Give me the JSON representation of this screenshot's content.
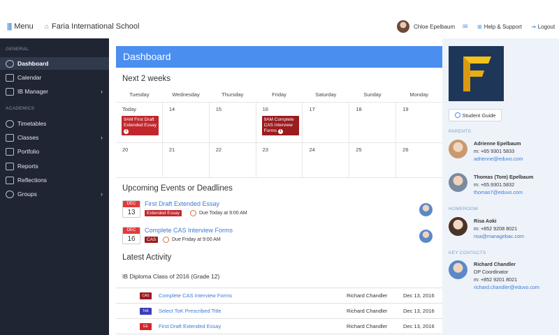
{
  "topbar": {
    "menu_label": "Menu",
    "school_name": "Faria International School",
    "user_name": "Chloe Epelbaum",
    "help_label": "Help & Support",
    "logout_label": "Logout"
  },
  "sidebar": {
    "sections": [
      "GENERAL",
      "ACADEMICS"
    ],
    "items": [
      {
        "label": "Dashboard",
        "icon": "dashboard-icon"
      },
      {
        "label": "Calendar",
        "icon": "calendar-icon"
      },
      {
        "label": "IB Manager",
        "icon": "ib-manager-icon"
      },
      {
        "label": "Timetables",
        "icon": "clock-icon"
      },
      {
        "label": "Classes",
        "icon": "classes-icon"
      },
      {
        "label": "Portfolio",
        "icon": "folder-icon"
      },
      {
        "label": "Reports",
        "icon": "reports-icon"
      },
      {
        "label": "Reflections",
        "icon": "reflections-icon"
      },
      {
        "label": "Groups",
        "icon": "groups-icon"
      }
    ]
  },
  "main": {
    "header": "Dashboard",
    "next_title": "Next 2 weeks",
    "days": [
      "Tuesday",
      "Wednesday",
      "Thursday",
      "Friday",
      "Saturday",
      "Sunday",
      "Monday"
    ],
    "week1": [
      "Today",
      "14",
      "15",
      "16",
      "17",
      "18",
      "19"
    ],
    "week2": [
      "20",
      "21",
      "22",
      "23",
      "24",
      "25",
      "26"
    ],
    "cal_event1": "9AM First Draft Extended Essay",
    "cal_event2": "9AM Complete CAS Interview Forms",
    "upcoming_title": "Upcoming Events or Deadlines",
    "events": [
      {
        "month": "DEC",
        "day": "13",
        "title": "First Draft Extended Essay",
        "tag": "Extended Essay",
        "due": "Due Today at 9:00 AM"
      },
      {
        "month": "DEC",
        "day": "16",
        "title": "Complete CAS Interview Forms",
        "tag": "CAS",
        "due": "Due Friday at 9:00 AM"
      }
    ],
    "latest_title": "Latest Activity",
    "class_label": "IB Diploma Class of 2016 (Grade 12)",
    "activity": [
      {
        "badge": "CAS",
        "title": "Complete CAS Interview Forms",
        "person": "Richard Chandler",
        "date": "Dec 13, 2016",
        "color": "#9b1b1f"
      },
      {
        "badge": "ToK",
        "title": "Select ToK Prescribed Title",
        "person": "Richard Chandler",
        "date": "Dec 13, 2016",
        "color": "#3b3fb8"
      },
      {
        "badge": "EE",
        "title": "First Draft Extended Essay",
        "person": "Richard Chandler",
        "date": "Dec 13, 2016",
        "color": "#d4262c"
      }
    ]
  },
  "right": {
    "guide_label": "Student Guide",
    "parents_label": "PARENTS",
    "parents": [
      {
        "name": "Adrienne Epelbaum",
        "phone": "m: +65 9301 5833",
        "email": "adrienne@eduvo.com"
      },
      {
        "name": "Thomas (Tom) Epelbaum",
        "phone": "m: +65.9301.5832",
        "email": "thomas7@eduvo.com"
      }
    ],
    "homeroom_label": "HOMEROOM",
    "homeroom": {
      "name": "Risa Aoki",
      "phone": "m: +852 9208 8021",
      "email": "risa@managebac.com"
    },
    "key_label": "KEY CONTACTS",
    "key": {
      "name": "Richard Chandler",
      "role": "DP Coordinator",
      "phone": "m: +852 9201 8021",
      "email": "richard.chandler@eduvo.com"
    }
  }
}
